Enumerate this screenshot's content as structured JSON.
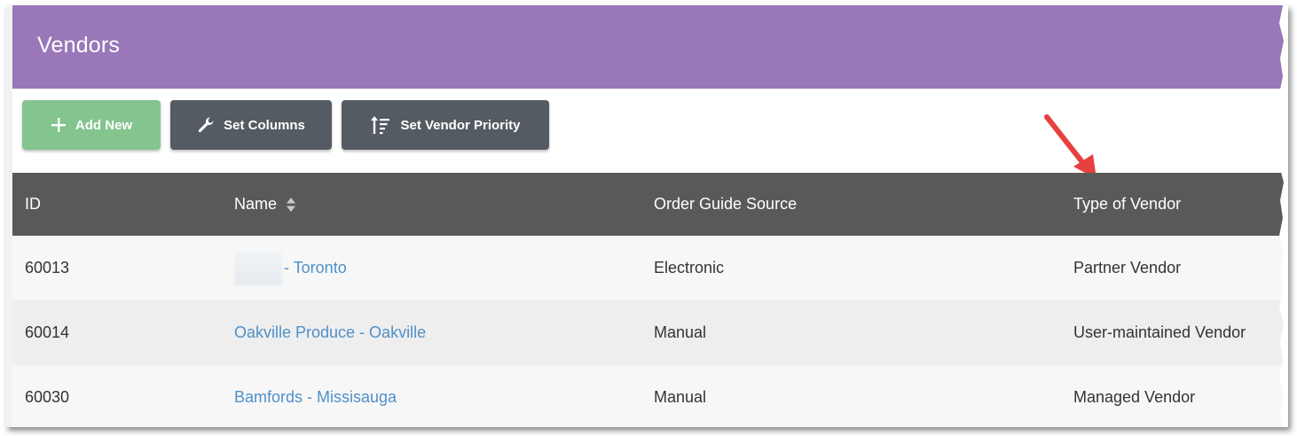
{
  "header": {
    "title": "Vendors"
  },
  "toolbar": {
    "add_new_label": "Add New",
    "set_columns_label": "Set Columns",
    "set_vendor_priority_label": "Set Vendor Priority"
  },
  "table": {
    "columns": [
      "ID",
      "Name",
      "Order Guide Source",
      "Type of Vendor"
    ],
    "rows": [
      {
        "id": "60013",
        "name": "- Toronto",
        "source": "Electronic",
        "type": "Partner Vendor"
      },
      {
        "id": "60014",
        "name": "Oakville Produce - Oakville",
        "source": "Manual",
        "type": "User-maintained Vendor"
      },
      {
        "id": "60030",
        "name": "Bamfords - Missisauga",
        "source": "Manual",
        "type": "Managed Vendor"
      }
    ]
  },
  "icons": {
    "add": "plus-icon",
    "columns": "wrench-icon",
    "priority": "sort-priority-icon",
    "sort": "sort-updown-icon",
    "annotation": "red-arrow-icon"
  },
  "colors": {
    "header_bg": "#9977b9",
    "add_button": "#84c48f",
    "dark_button": "#545b62",
    "table_header": "#595959",
    "link": "#4f8fc8",
    "annotation_arrow": "#e8403f"
  }
}
